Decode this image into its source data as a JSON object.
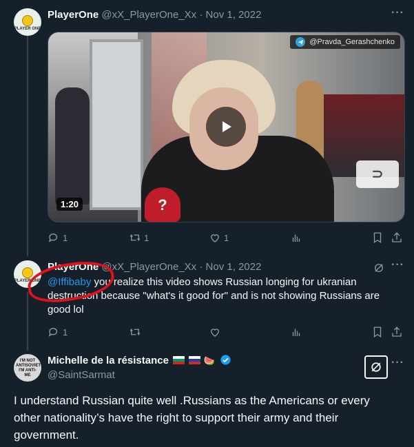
{
  "tweet1": {
    "author_name": "PlayerOne",
    "handle": "@xX_PlayerOne_Xx",
    "separator": "·",
    "date": "Nov 1, 2022",
    "avatar_text": "PLAYER ONE",
    "media": {
      "duration": "1:20",
      "watermark": "@Pravda_Gerashchenko"
    },
    "stats": {
      "replies": "1",
      "retweets": "1",
      "likes": "1"
    }
  },
  "tweet2": {
    "author_name": "PlayerOne",
    "handle": "@xX_PlayerOne_Xx",
    "separator": "·",
    "date": "Nov 1, 2022",
    "avatar_text": "PLAYER ONE",
    "mention": "@Iffibaby",
    "text": " you realize this video shows Russian longing for ukranian destruction because \"what's it good for\" and is not showing Russians are good lol",
    "stats": {
      "replies": "1",
      "retweets": "",
      "likes": ""
    }
  },
  "tweet3": {
    "author_name": "Michelle de la résistance",
    "handle": "@SaintSarmat",
    "emoji_watermelon": "🍉",
    "avatar_text": "I'M NOT ANTISOVIET I'M ANTI-ME",
    "text": "I understand Russian quite well .Russians as the Americans or every other nationality’s have the right to support their army and their government."
  },
  "colors": {
    "background": "#15202b",
    "text": "#f7f9f9",
    "muted": "#8b98a5",
    "accent": "#1d9bf0",
    "annotation_red": "#e1121a"
  },
  "icons": [
    "reply-icon",
    "retweet-icon",
    "like-icon",
    "views-icon",
    "bookmark-icon",
    "share-icon",
    "more-icon",
    "grok-icon",
    "play-icon",
    "telegram-icon",
    "verified-icon"
  ]
}
